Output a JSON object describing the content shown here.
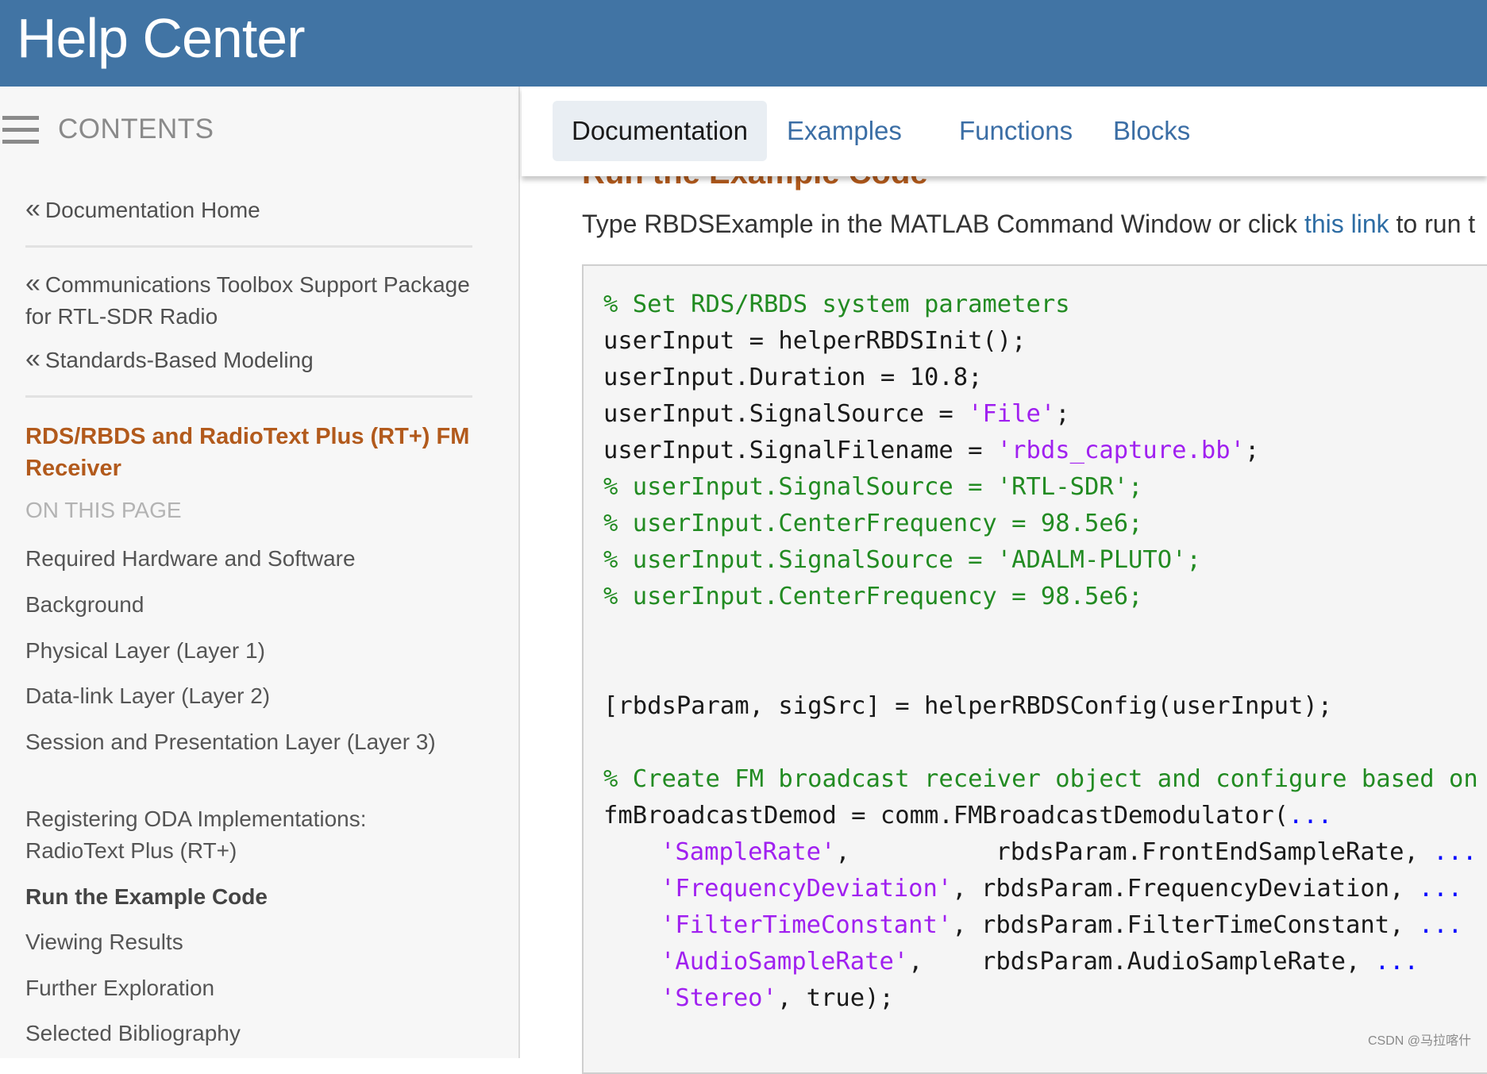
{
  "colors": {
    "header_bg": "#4174a4",
    "tab_color": "#3b6ea5",
    "link_color": "#2e6da4",
    "current_page_color": "#b25a1c"
  },
  "header": {
    "title": "Help Center"
  },
  "sidebar": {
    "menu_icon": "hamburger-icon",
    "contents_label": "CONTENTS",
    "breadcrumbs": [
      {
        "label": "Documentation Home"
      },
      {
        "label": "Communications Toolbox Support Package for RTL-SDR Radio"
      },
      {
        "label": "Standards-Based Modeling"
      }
    ],
    "current_page": "RDS/RBDS and RadioText Plus (RT+) FM Receiver",
    "on_this_page": "ON THIS PAGE",
    "toc": [
      "Required Hardware and Software",
      "Background",
      "Physical Layer (Layer 1)",
      "Data-link Layer (Layer 2)",
      "Session and Presentation Layer (Layer 3)",
      "Registering ODA Implementations: RadioText Plus (RT+)",
      "Run the Example Code",
      "Viewing Results",
      "Further Exploration",
      "Selected Bibliography"
    ],
    "active_toc": "Run the Example Code"
  },
  "tabs": [
    "Documentation",
    "Examples",
    "Functions",
    "Blocks"
  ],
  "active_tab": "Documentation",
  "content": {
    "section_heading": "Run the Example Code",
    "intro_before": "Type RBDSExample in the MATLAB Command Window or click ",
    "intro_link": "this link",
    "intro_after": " to run t"
  },
  "code": {
    "line_01": "% Set RDS/RBDS system parameters",
    "line_02": "userInput = helperRBDSInit();",
    "line_03": "userInput.Duration = 10.8;",
    "line_04a": "userInput.SignalSource = ",
    "line_04b": "'File'",
    "line_04c": ";",
    "line_05a": "userInput.SignalFilename = ",
    "line_05b": "'rbds_capture.bb'",
    "line_05c": ";",
    "line_06": "% userInput.SignalSource = 'RTL-SDR';",
    "line_07": "% userInput.CenterFrequency = 98.5e6;",
    "line_08": "% userInput.SignalSource = 'ADALM-PLUTO';",
    "line_09": "% userInput.CenterFrequency = 98.5e6;",
    "line_10": "[rbdsParam, sigSrc] = helperRBDSConfig(userInput);",
    "line_11": "% Create FM broadcast receiver object and configure based on RI",
    "line_12a": "fmBroadcastDemod = comm.FMBroadcastDemodulator(",
    "line_12b": "...",
    "line_13a": "'SampleRate'",
    "line_13b": ",          rbdsParam.FrontEndSampleRate, ",
    "line_13c": "...",
    "line_14a": "'FrequencyDeviation'",
    "line_14b": ", rbdsParam.FrequencyDeviation, ",
    "line_14c": "...",
    "line_15a": "'FilterTimeConstant'",
    "line_15b": ", rbdsParam.FilterTimeConstant, ",
    "line_15c": "...",
    "line_16a": "'AudioSampleRate'",
    "line_16b": ",    rbdsParam.AudioSampleRate, ",
    "line_16c": "...",
    "line_17a": "'Stereo'",
    "line_17b": ", true);"
  },
  "watermark": "CSDN @马拉喀什"
}
